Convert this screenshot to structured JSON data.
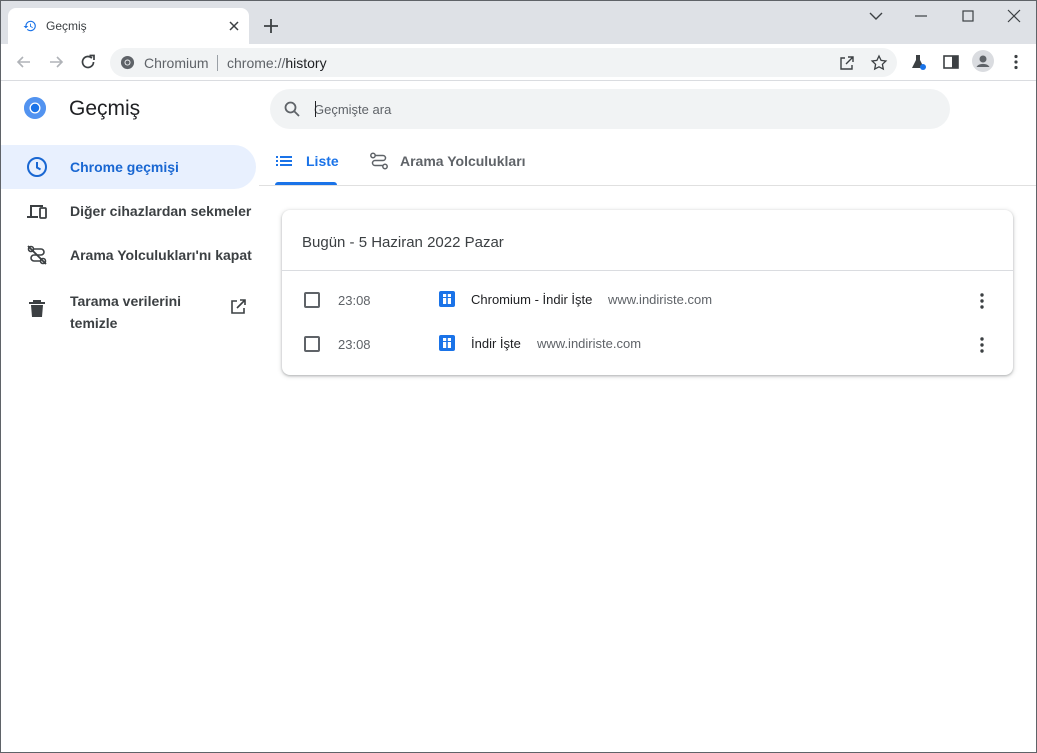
{
  "tab": {
    "title": "Geçmiş"
  },
  "toolbar": {
    "omnibox": {
      "site_label": "Chromium",
      "url_scheme": "chrome://",
      "url_path": "history"
    }
  },
  "app": {
    "title": "Geçmiş"
  },
  "sidebar": {
    "items": [
      {
        "label": "Chrome geçmişi",
        "icon": "clock-icon",
        "active": true
      },
      {
        "label": "Diğer cihazlardan sekmeler",
        "icon": "devices-icon"
      },
      {
        "label": "Arama Yolculukları'nı kapat",
        "icon": "journeys-off-icon"
      },
      {
        "label": "Tarama verilerini temizle",
        "icon": "trash-icon",
        "external": "external-link-icon"
      }
    ]
  },
  "search": {
    "placeholder": "Geçmişte ara"
  },
  "content_tabs": [
    {
      "label": "Liste",
      "icon": "list-icon",
      "active": true
    },
    {
      "label": "Arama Yolculukları",
      "icon": "journeys-icon"
    }
  ],
  "history_card": {
    "date_title": "Bugün - 5 Haziran 2022 Pazar",
    "entries": [
      {
        "time": "23:08",
        "title": "Chromium - İndir İşte",
        "domain": "www.indiriste.com"
      },
      {
        "time": "23:08",
        "title": "İndir İşte",
        "domain": "www.indiriste.com"
      }
    ]
  },
  "colors": {
    "accent": "#1a73e8",
    "active_bg": "#e8f0fe",
    "tabstrip": "#dee1e6"
  }
}
